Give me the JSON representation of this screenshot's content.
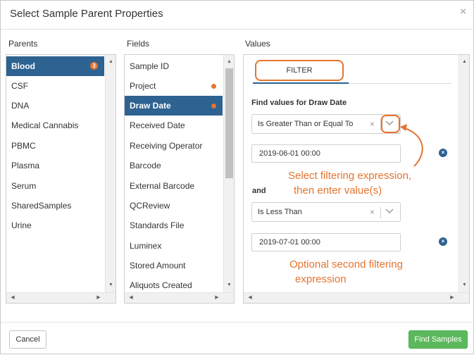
{
  "dialog": {
    "title": "Select Sample Parent Properties",
    "close_glyph": "×"
  },
  "columns": {
    "parents": "Parents",
    "fields": "Fields",
    "values": "Values"
  },
  "parents": {
    "items": [
      {
        "label": "Blood",
        "badge": "3",
        "active": true
      },
      {
        "label": "CSF"
      },
      {
        "label": "DNA"
      },
      {
        "label": "Medical Cannabis"
      },
      {
        "label": "PBMC"
      },
      {
        "label": "Plasma"
      },
      {
        "label": "Serum"
      },
      {
        "label": "SharedSamples"
      },
      {
        "label": "Urine"
      }
    ]
  },
  "fields": {
    "items": [
      {
        "label": "Sample ID"
      },
      {
        "label": "Project",
        "dot": true
      },
      {
        "label": "Draw Date",
        "dot": true,
        "active": true
      },
      {
        "label": "Received Date"
      },
      {
        "label": "Receiving Operator"
      },
      {
        "label": "Barcode"
      },
      {
        "label": "External Barcode"
      },
      {
        "label": "QCReview"
      },
      {
        "label": "Standards File"
      },
      {
        "label": "Luminex"
      },
      {
        "label": "Stored Amount"
      },
      {
        "label": "Aliquots Created"
      }
    ]
  },
  "values": {
    "tab_label": "FILTER",
    "find_label": "Find values for Draw Date",
    "filter1": {
      "expression": "Is Greater Than or Equal To",
      "value": "2019-06-01 00:00"
    },
    "and_label": "and",
    "filter2": {
      "expression": "Is Less Than",
      "value": "2019-07-01 00:00"
    }
  },
  "annotations": {
    "first": [
      "Select filtering expression,",
      "then enter value(s)"
    ],
    "second": [
      "Optional second filtering",
      "expression"
    ]
  },
  "footer": {
    "cancel_label": "Cancel",
    "find_label": "Find Samples"
  },
  "colors": {
    "primary": "#2d6291",
    "accent": "#e4742f",
    "success": "#5cb85c"
  },
  "icons": {
    "clear": "×",
    "clear_value": "×",
    "scroll_up": "▲",
    "scroll_down": "▼",
    "scroll_left": "◀",
    "scroll_right": "▶"
  }
}
